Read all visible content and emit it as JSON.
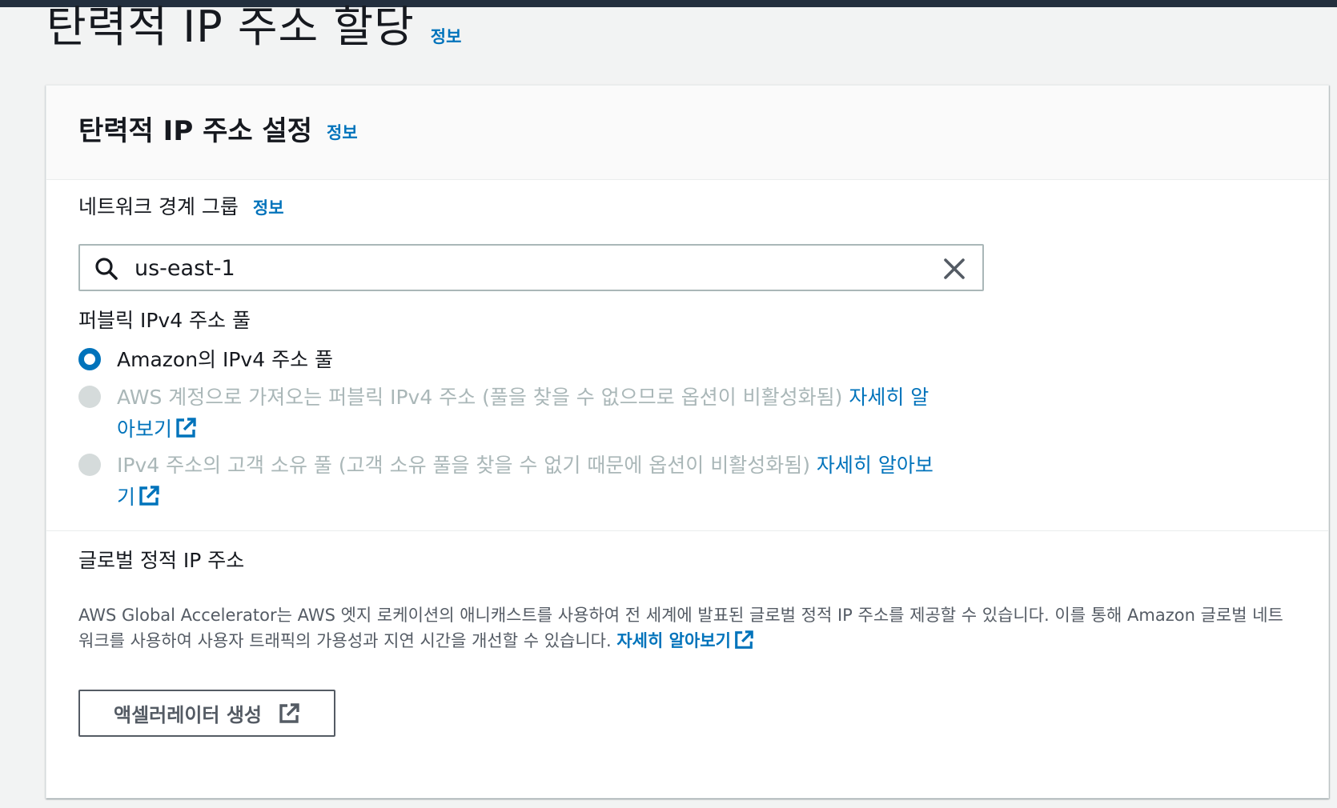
{
  "page": {
    "title": "탄력적 IP 주소 할당",
    "info": "정보"
  },
  "panel": {
    "title": "탄력적 IP 주소 설정",
    "info": "정보"
  },
  "network_border_group": {
    "label": "네트워크 경계 그룹",
    "info": "정보",
    "value": "us-east-1",
    "search_icon": "search-icon",
    "clear_icon": "close-icon"
  },
  "ipv4_pool": {
    "label": "퍼블릭 IPv4 주소 풀",
    "options": [
      {
        "text": "Amazon의 IPv4 주소 풀",
        "checked": true,
        "disabled": false,
        "link": ""
      },
      {
        "text": "AWS 계정으로 가져오는 퍼블릭 IPv4 주소 (풀을 찾을 수 없으므로 옵션이 비활성화됨) ",
        "checked": false,
        "disabled": true,
        "link": "자세히 알아보기"
      },
      {
        "text": "IPv4 주소의 고객 소유 풀 (고객 소유 풀을 찾을 수 없기 때문에 옵션이 비활성화됨) ",
        "checked": false,
        "disabled": true,
        "link": "자세히 알아보기"
      }
    ]
  },
  "global_static_ip": {
    "label": "글로벌 정적 IP 주소",
    "description": "AWS Global Accelerator는 AWS 엣지 로케이션의 애니캐스트를 사용하여 전 세계에 발표된 글로벌 정적 IP 주소를 제공할 수 있습니다. 이를 통해 Amazon 글로벌 네트워크를 사용하여 사용자 트래픽의 가용성과 지연 시간을 개선할 수 있습니다. ",
    "learn_more": "자세히 알아보기",
    "button_label": "액셀러레이터 생성",
    "external_icon": "external-link-icon"
  },
  "colors": {
    "link": "#0073bb",
    "radio_checked": "#0073bb",
    "radio_disabled": "#d5dbdb",
    "topbar": "#232f3e"
  }
}
